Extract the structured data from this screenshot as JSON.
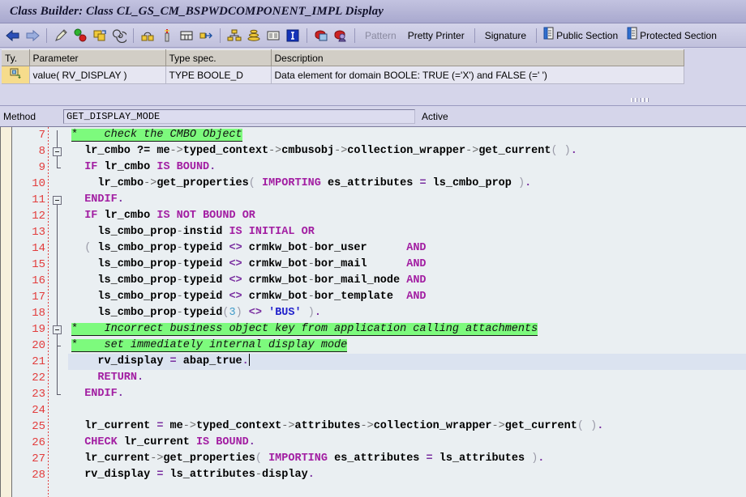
{
  "window": {
    "title": "Class Builder: Class CL_GS_CM_BSPWDCOMPONENT_IMPL Display"
  },
  "toolbar": {
    "icons": [
      {
        "name": "back-arrow-icon",
        "label": "Back"
      },
      {
        "name": "forward-arrow-icon",
        "label": "Forward"
      },
      {
        "name": "pencil-edit-icon",
        "label": "Change"
      },
      {
        "name": "check-syntax-icon",
        "label": "Check"
      },
      {
        "name": "activate-icon",
        "label": "Activate"
      },
      {
        "name": "pattern-spiral-icon",
        "label": "Where-Used"
      },
      {
        "name": "generate-icon",
        "label": "Generate"
      },
      {
        "name": "insert-icon",
        "label": "Insert"
      },
      {
        "name": "display-object-icon",
        "label": "Display Object List"
      },
      {
        "name": "navigate-icon",
        "label": "Navigate"
      },
      {
        "name": "hierarchy-icon",
        "label": "Class Hierarchy"
      },
      {
        "name": "stack-icon",
        "label": "Inheritance"
      },
      {
        "name": "list-icon",
        "label": "List"
      },
      {
        "name": "info-icon",
        "label": "Information"
      },
      {
        "name": "local-types-icon",
        "label": "Local Types"
      },
      {
        "name": "user-object-icon",
        "label": "Object"
      }
    ],
    "pattern_label": "Pattern",
    "pretty_printer_label": "Pretty Printer",
    "signature_label": "Signature",
    "public_section_label": "Public Section",
    "protected_section_label": "Protected Section"
  },
  "parameter_table": {
    "columns": [
      "Ty.",
      "Parameter",
      "Type spec.",
      "Description"
    ],
    "rows": [
      {
        "type_icon": "returning-parameter-icon",
        "parameter": "value( RV_DISPLAY )",
        "type_spec": "TYPE BOOLE_D",
        "description": "Data element for domain BOOLE: TRUE (='X') and FALSE (=' ')"
      }
    ]
  },
  "method_bar": {
    "label": "Method",
    "value": "GET_DISPLAY_MODE",
    "placeholder": "",
    "status": "Active"
  },
  "editor": {
    "first_line_number": 7,
    "current_line_number": 21,
    "lines": [
      {
        "n": 7,
        "type": "comment",
        "text": "*    check the CMBO Object"
      },
      {
        "n": 8,
        "type": "code",
        "text": "  lr_cmbo ?= me->typed_context->cmbusobj->collection_wrapper->get_current( )."
      },
      {
        "n": 9,
        "type": "code",
        "text": "  IF lr_cmbo IS BOUND."
      },
      {
        "n": 10,
        "type": "code",
        "text": "    lr_cmbo->get_properties( IMPORTING es_attributes = ls_cmbo_prop )."
      },
      {
        "n": 11,
        "type": "code",
        "text": "  ENDIF."
      },
      {
        "n": 12,
        "type": "code",
        "text": "  IF lr_cmbo IS NOT BOUND OR"
      },
      {
        "n": 13,
        "type": "code",
        "text": "    ls_cmbo_prop-instid IS INITIAL OR"
      },
      {
        "n": 14,
        "type": "code",
        "text": "  ( ls_cmbo_prop-typeid <> crmkw_bot-bor_user      AND"
      },
      {
        "n": 15,
        "type": "code",
        "text": "    ls_cmbo_prop-typeid <> crmkw_bot-bor_mail      AND"
      },
      {
        "n": 16,
        "type": "code",
        "text": "    ls_cmbo_prop-typeid <> crmkw_bot-bor_mail_node AND"
      },
      {
        "n": 17,
        "type": "code",
        "text": "    ls_cmbo_prop-typeid <> crmkw_bot-bor_template  AND"
      },
      {
        "n": 18,
        "type": "code",
        "text": "    ls_cmbo_prop-typeid(3) <> 'BUS' )."
      },
      {
        "n": 19,
        "type": "comment",
        "text": "*    Incorrect business object key from application calling attachments"
      },
      {
        "n": 20,
        "type": "comment",
        "text": "*    set immediately internal display mode"
      },
      {
        "n": 21,
        "type": "code",
        "text": "    rv_display = abap_true."
      },
      {
        "n": 22,
        "type": "code",
        "text": "    RETURN."
      },
      {
        "n": 23,
        "type": "code",
        "text": "  ENDIF."
      },
      {
        "n": 24,
        "type": "code",
        "text": ""
      },
      {
        "n": 25,
        "type": "code",
        "text": "  lr_current = me->typed_context->attributes->collection_wrapper->get_current( )."
      },
      {
        "n": 26,
        "type": "code",
        "text": "  CHECK lr_current IS BOUND."
      },
      {
        "n": 27,
        "type": "code",
        "text": "  lr_current->get_properties( IMPORTING es_attributes = ls_attributes )."
      },
      {
        "n": 28,
        "type": "code",
        "text": "  rv_display = ls_attributes-display."
      }
    ]
  },
  "colors": {
    "title_bar": "#b4b4d6",
    "toolbar": "#cacae3",
    "panel": "#d5d5ea",
    "editor_bg": "#eaeff2",
    "gutter_beige": "#f6f0dc",
    "line_number": "#e23c3c",
    "comment_bg": "#7dfa7d",
    "keyword": "#a21ea2",
    "current_line": "#dbe3f0",
    "ty_cell": "#f6dc8c"
  }
}
